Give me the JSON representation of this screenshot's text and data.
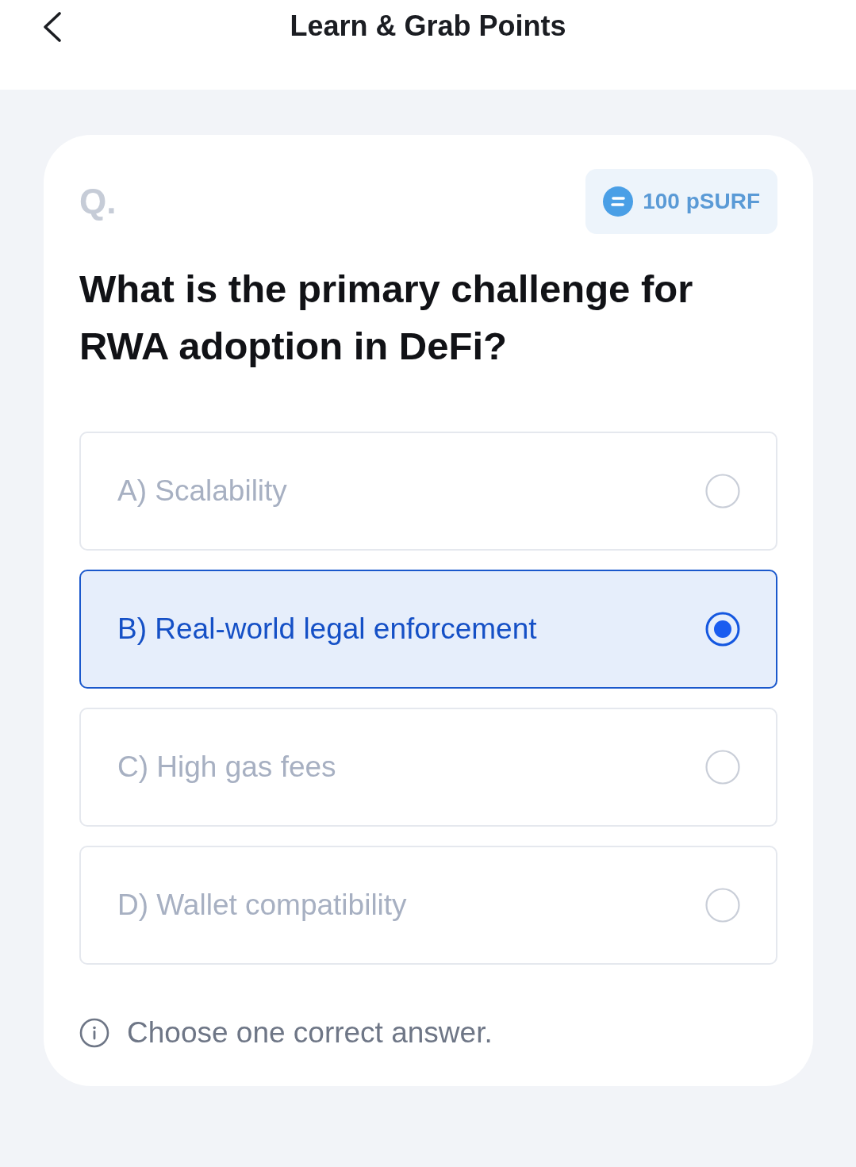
{
  "header": {
    "title": "Learn & Grab Points"
  },
  "quiz": {
    "question_marker": "Q.",
    "reward": {
      "amount": "100 pSURF"
    },
    "question": "What is the primary challenge for RWA adoption in DeFi?",
    "options": [
      {
        "label": "A) Scalability",
        "selected": false
      },
      {
        "label": "B) Real-world legal enforcement",
        "selected": true
      },
      {
        "label": "C) High gas fees",
        "selected": false
      },
      {
        "label": "D) Wallet compatibility",
        "selected": false
      }
    ],
    "hint": "Choose one correct answer."
  }
}
